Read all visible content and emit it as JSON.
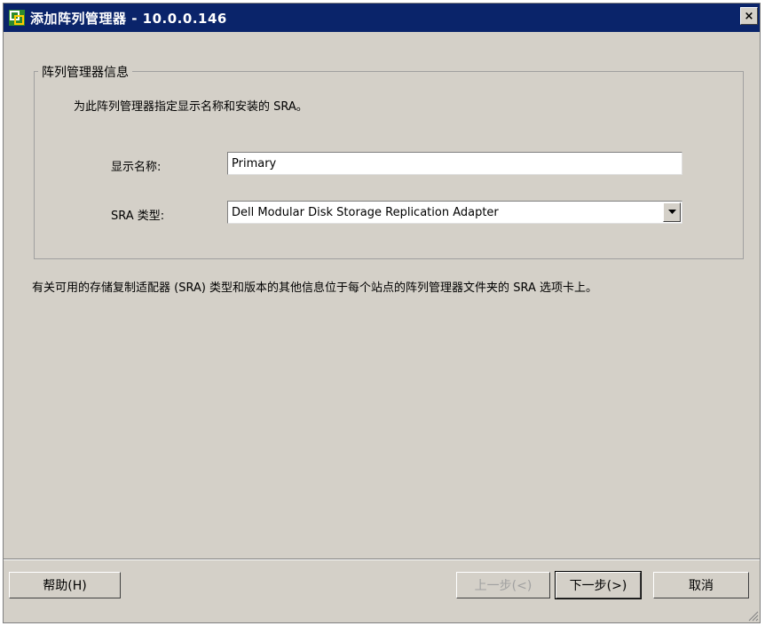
{
  "window": {
    "title": "添加阵列管理器 - 10.0.0.146",
    "close_label": "×"
  },
  "group": {
    "legend": "阵列管理器信息",
    "description": "为此阵列管理器指定显示名称和安装的 SRA。",
    "display_name_label": "显示名称:",
    "display_name_value": "Primary",
    "sra_type_label": "SRA 类型:",
    "sra_type_value": "Dell Modular Disk Storage Replication Adapter"
  },
  "info_text": "有关可用的存储复制适配器 (SRA) 类型和版本的其他信息位于每个站点的阵列管理器文件夹的 SRA 选项卡上。",
  "buttons": {
    "help": "帮助(H)",
    "back": "上一步(<)",
    "next": "下一步(>)",
    "cancel": "取消"
  }
}
